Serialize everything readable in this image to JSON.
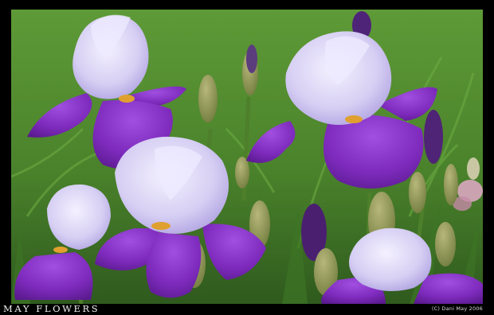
{
  "caption": "MAY FLOWERS",
  "credit": "(C) Dani May 2006",
  "colors": {
    "frame": "#000000",
    "grass": "#4f8a2e",
    "standard_petal": "#dcd6f4",
    "fall_petal": "#8a2fc9",
    "bud": "#8c9a55"
  }
}
